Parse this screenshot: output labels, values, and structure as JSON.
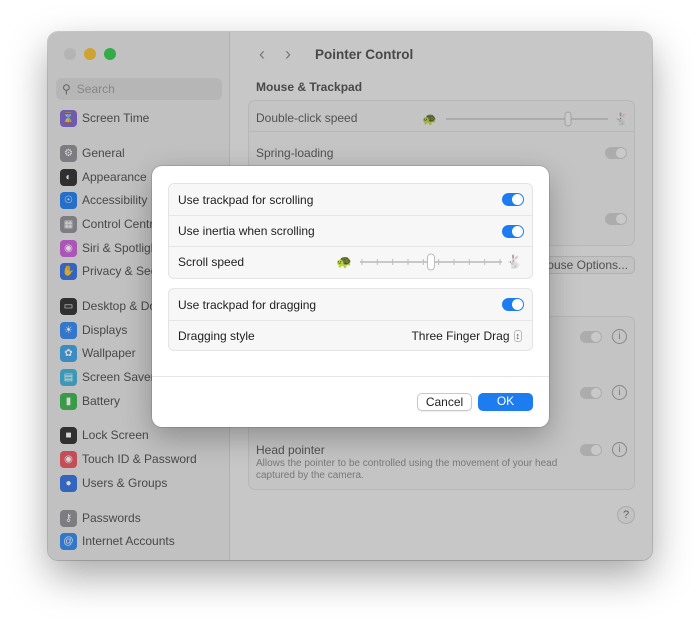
{
  "window": {
    "title": "Pointer Control"
  },
  "sidebar": {
    "search_placeholder": "Search",
    "items": [
      {
        "label": "Screen Time",
        "icon": "hourglass-icon",
        "color": "#7b61c9"
      },
      {
        "label": "General",
        "icon": "gear-icon",
        "color": "#8e8e93"
      },
      {
        "label": "Appearance",
        "icon": "appearance-icon",
        "color": "#2b2b2b"
      },
      {
        "label": "Accessibility",
        "icon": "accessibility-icon",
        "color": "#1c7cf0"
      },
      {
        "label": "Control Centre",
        "icon": "control-centre-icon",
        "color": "#8e8e93"
      },
      {
        "label": "Siri & Spotlight",
        "icon": "siri-icon",
        "color": "#c85ad6"
      },
      {
        "label": "Privacy & Security",
        "icon": "hand-icon",
        "color": "#2f6ee0"
      },
      {
        "label": "Desktop & Dock",
        "icon": "dock-icon",
        "color": "#2b2b2b"
      },
      {
        "label": "Displays",
        "icon": "sun-icon",
        "color": "#2f86f0"
      },
      {
        "label": "Wallpaper",
        "icon": "wallpaper-icon",
        "color": "#3aa0e8"
      },
      {
        "label": "Screen Saver",
        "icon": "screensaver-icon",
        "color": "#3ab0d8"
      },
      {
        "label": "Battery",
        "icon": "battery-icon",
        "color": "#36b34a"
      },
      {
        "label": "Lock Screen",
        "icon": "lock-icon",
        "color": "#2b2b2b"
      },
      {
        "label": "Touch ID & Password",
        "icon": "fingerprint-icon",
        "color": "#e8505b"
      },
      {
        "label": "Users & Groups",
        "icon": "users-icon",
        "color": "#2f6ee0"
      },
      {
        "label": "Passwords",
        "icon": "key-icon",
        "color": "#8e8e93"
      },
      {
        "label": "Internet Accounts",
        "icon": "at-icon",
        "color": "#2f86f0"
      }
    ]
  },
  "main": {
    "section_title": "Mouse & Trackpad",
    "rows": {
      "double_click_speed": "Double-click speed",
      "spring_loading": "Spring-loading",
      "mouse_options_button": "Mouse Options...",
      "head_pointer": "Head pointer",
      "head_pointer_desc": "Allows the pointer to be controlled using the movement of your head captured by the camera."
    },
    "help": "?"
  },
  "dialog": {
    "scrolling": {
      "use_trackpad_for_scrolling": "Use trackpad for scrolling",
      "use_inertia": "Use inertia when scrolling",
      "scroll_speed": "Scroll speed",
      "scroll_speed_level": 0.5
    },
    "dragging": {
      "use_trackpad_for_dragging": "Use trackpad for dragging",
      "dragging_style": "Dragging style",
      "dragging_style_value": "Three Finger Drag"
    },
    "cancel": "Cancel",
    "ok": "OK",
    "accent": "#1c7cf0"
  }
}
